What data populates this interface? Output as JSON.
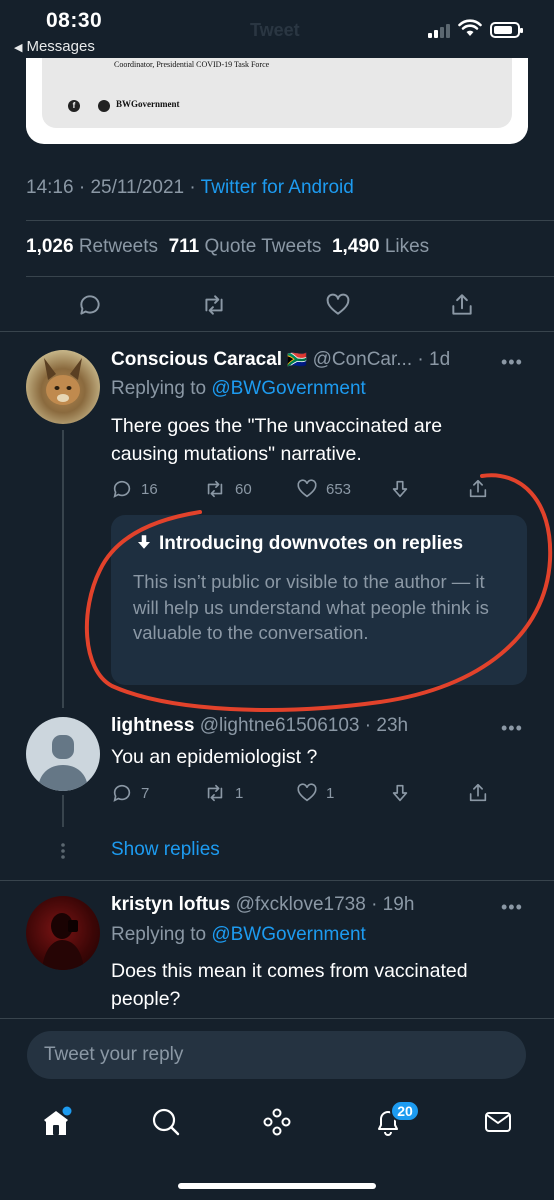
{
  "status_bar": {
    "time": "08:30",
    "back_label": "Messages",
    "header_faint": "Tweet"
  },
  "embedded_document": {
    "signature_line": "Coordinator, Presidential COVID-19 Task Force",
    "social_handle": "BWGovernment",
    "facebook_glyph": "f"
  },
  "tweet_meta": {
    "time": "14:16",
    "date": "25/11/2021",
    "separator": "·",
    "source": "Twitter for Android"
  },
  "tweet_stats": {
    "retweets_count": "1,026",
    "retweets_label": "Retweets",
    "quotes_count": "711",
    "quotes_label": "Quote Tweets",
    "likes_count": "1,490",
    "likes_label": "Likes"
  },
  "replies": [
    {
      "display_name": "Conscious Caracal",
      "flag": "🇿🇦",
      "handle": "@ConCar...",
      "age": "· 1d",
      "replying_prefix": "Replying to",
      "replying_to": "@BWGovernment",
      "text": "There goes the \"The unvaccinated are causing mutations\" narrative.",
      "reply_count": "16",
      "retweet_count": "60",
      "like_count": "653"
    },
    {
      "display_name": "lightness",
      "handle": "@lightne61506103",
      "age": "· 23h",
      "text": "You an epidemiologist ?",
      "reply_count": "7",
      "retweet_count": "1",
      "like_count": "1"
    },
    {
      "display_name": "kristyn loftus",
      "handle": "@fxcklove1738",
      "age": "· 19h",
      "replying_prefix": "Replying to",
      "replying_to": "@BWGovernment",
      "text": "Does this mean it comes from vaccinated people?"
    }
  ],
  "downvote_notice": {
    "title": "Introducing downvotes on replies",
    "body": "This isn’t public or visible to the author — it will help us understand what people think is valuable to the conversation."
  },
  "show_replies": "Show replies",
  "more_glyph": "•••",
  "reply_input": {
    "placeholder": "Tweet your reply"
  },
  "tabbar": {
    "notifications_badge": "20",
    "icons": [
      "home-icon",
      "search-icon",
      "spaces-icon",
      "notifications-icon",
      "messages-icon"
    ]
  },
  "colors": {
    "background": "#15202b",
    "accent": "#1d9bf0",
    "secondary_text": "#8b98a5",
    "annotation": "#e2422b"
  }
}
